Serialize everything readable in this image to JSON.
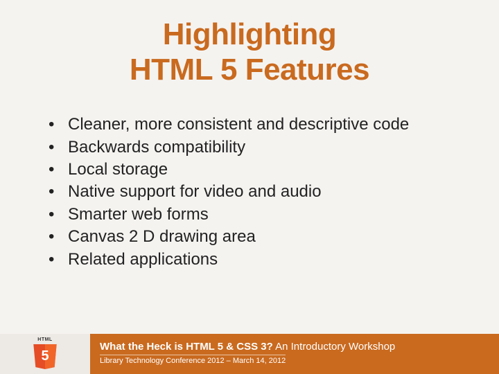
{
  "title_line1": "Highlighting",
  "title_line2": "HTML 5 Features",
  "bullets": [
    "Cleaner, more consistent and descriptive code",
    "Backwards compatibility",
    "Local storage",
    "Native support for video and audio",
    "Smarter web forms",
    "Canvas 2 D drawing area",
    "Related applications"
  ],
  "logo_text": "HTML",
  "logo_number": "5",
  "footer_title_bold": "What the Heck is HTML 5 & CSS 3?",
  "footer_title_rest": "  An Introductory Workshop",
  "footer_sub": "Library Technology Conference 2012 – March  14, 2012"
}
